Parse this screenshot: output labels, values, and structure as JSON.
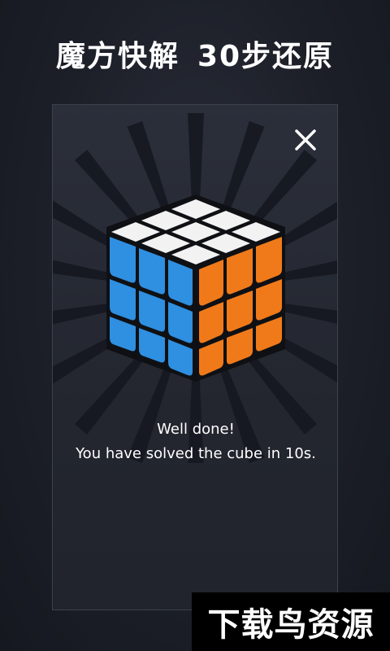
{
  "header": {
    "title_part1": "魔方快解",
    "title_part2": "30步还原"
  },
  "dialog": {
    "message_title": "Well done!",
    "message_body": "You have solved the cube in 10s.",
    "close_icon": "close-icon"
  },
  "cube": {
    "icon": "rubiks-cube-icon",
    "colors": {
      "top": "#f2f2f2",
      "left": "#2f8fe0",
      "right": "#f07a1a"
    }
  },
  "watermark": {
    "text": "下载鸟资源"
  }
}
